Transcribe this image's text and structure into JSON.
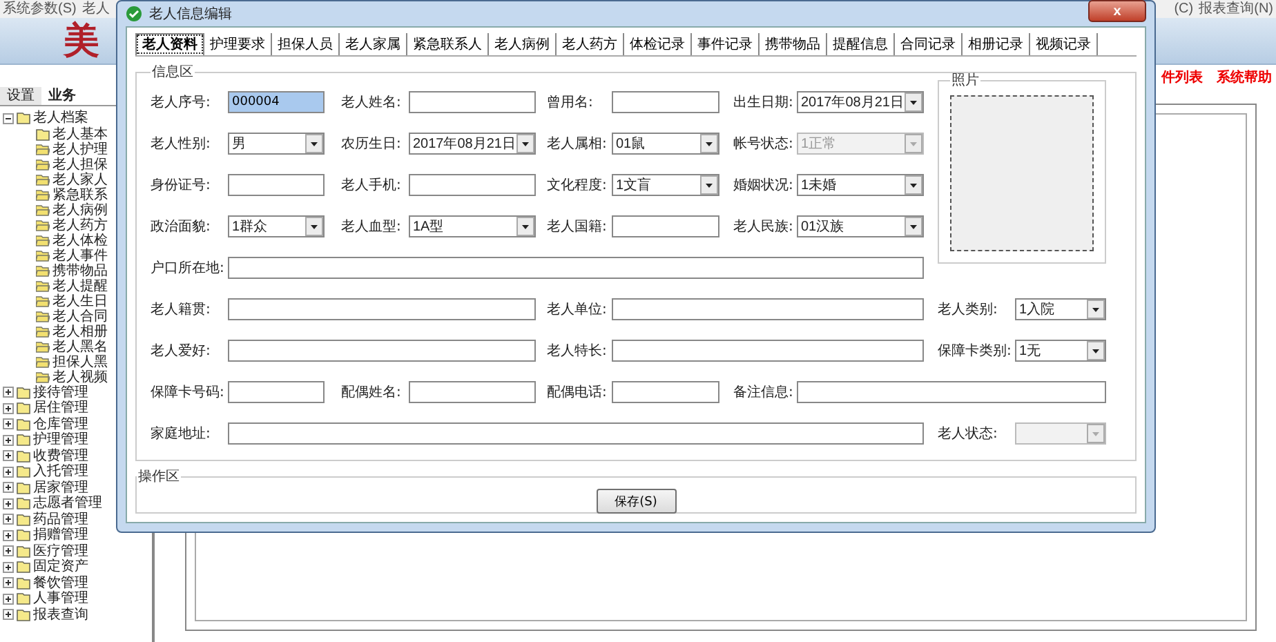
{
  "menu_bar": {
    "left": [
      "系统参数(S)",
      "老人"
    ],
    "right": [
      "(C)",
      "报表查询(N)"
    ]
  },
  "header": {
    "logo": "美",
    "links": [
      "件列表",
      "系统帮助"
    ]
  },
  "sidebar": {
    "tabs": [
      {
        "label": "设置",
        "selected": false
      },
      {
        "label": "业务",
        "selected": true
      }
    ],
    "tree": [
      {
        "label": "老人档案",
        "expanded": true,
        "children": [
          "老人基本",
          "老人护理",
          "老人担保",
          "老人家人",
          "紧急联系",
          "老人病例",
          "老人药方",
          "老人体检",
          "老人事件",
          "携带物品",
          "老人提醒",
          "老人生日",
          "老人合同",
          "老人相册",
          "老人黑名",
          "担保人黑",
          "老人视频"
        ]
      },
      {
        "label": "接待管理",
        "expanded": false
      },
      {
        "label": "居住管理",
        "expanded": false
      },
      {
        "label": "仓库管理",
        "expanded": false
      },
      {
        "label": "护理管理",
        "expanded": false
      },
      {
        "label": "收费管理",
        "expanded": false
      },
      {
        "label": "入托管理",
        "expanded": false
      },
      {
        "label": "居家管理",
        "expanded": false
      },
      {
        "label": "志愿者管理",
        "expanded": false
      },
      {
        "label": "药品管理",
        "expanded": false
      },
      {
        "label": "捐赠管理",
        "expanded": false
      },
      {
        "label": "医疗管理",
        "expanded": false
      },
      {
        "label": "固定资产",
        "expanded": false
      },
      {
        "label": "餐饮管理",
        "expanded": false
      },
      {
        "label": "人事管理",
        "expanded": false
      },
      {
        "label": "报表查询",
        "expanded": false
      }
    ]
  },
  "dialog": {
    "title": "老人信息编辑",
    "close": "x",
    "tabs": [
      {
        "label": "老人资料",
        "selected": true
      },
      {
        "label": "护理要求",
        "selected": false
      },
      {
        "label": "担保人员",
        "selected": false
      },
      {
        "label": "老人家属",
        "selected": false
      },
      {
        "label": "紧急联系人",
        "selected": false
      },
      {
        "label": "老人病例",
        "selected": false
      },
      {
        "label": "老人药方",
        "selected": false
      },
      {
        "label": "体检记录",
        "selected": false
      },
      {
        "label": "事件记录",
        "selected": false
      },
      {
        "label": "携带物品",
        "selected": false
      },
      {
        "label": "提醒信息",
        "selected": false
      },
      {
        "label": "合同记录",
        "selected": false
      },
      {
        "label": "相册记录",
        "selected": false
      },
      {
        "label": "视频记录",
        "selected": false
      }
    ],
    "info_group": "信息区",
    "photo_label": "照片",
    "rows": [
      [
        {
          "label": "老人序号:",
          "kind": "text",
          "value": "000004",
          "focused": true
        },
        {
          "label": "老人姓名:",
          "kind": "text"
        },
        {
          "label": "曾用名:",
          "kind": "text"
        },
        {
          "label": "出生日期:",
          "kind": "select",
          "value": "2017年08月21日",
          "disabled": false
        }
      ],
      [
        {
          "label": "老人性别:",
          "kind": "select",
          "value": "男",
          "disabled": false
        },
        {
          "label": "农历生日:",
          "kind": "select",
          "value": "2017年08月21日",
          "disabled": false
        },
        {
          "label": "老人属相:",
          "kind": "select",
          "value": "01鼠",
          "disabled": false
        },
        {
          "label": "帐号状态:",
          "kind": "select",
          "value": "1正常",
          "disabled": true
        }
      ],
      [
        {
          "label": "身份证号:",
          "kind": "text"
        },
        {
          "label": "老人手机:",
          "kind": "text"
        },
        {
          "label": "文化程度:",
          "kind": "select",
          "value": "1文盲",
          "disabled": false
        },
        {
          "label": "婚姻状况:",
          "kind": "select",
          "value": "1未婚",
          "disabled": false
        }
      ],
      [
        {
          "label": "政治面貌:",
          "kind": "select",
          "value": "1群众",
          "disabled": false
        },
        {
          "label": "老人血型:",
          "kind": "select",
          "value": "1A型",
          "disabled": false
        },
        {
          "label": "老人国籍:",
          "kind": "text"
        },
        {
          "label": "老人民族:",
          "kind": "select",
          "value": "01汉族",
          "disabled": false
        }
      ],
      [
        {
          "label": "户口所在地:",
          "kind": "text"
        }
      ],
      [
        {
          "label": "老人籍贯:",
          "kind": "text"
        },
        {
          "label": "老人单位:",
          "kind": "text"
        },
        {
          "label": "老人类别:",
          "kind": "select",
          "value": "1入院",
          "disabled": false
        }
      ],
      [
        {
          "label": "老人爱好:",
          "kind": "text"
        },
        {
          "label": "老人特长:",
          "kind": "text"
        },
        {
          "label": "保障卡类别:",
          "kind": "select",
          "value": "1无",
          "disabled": false
        }
      ],
      [
        {
          "label": "保障卡号码:",
          "kind": "text"
        },
        {
          "label": "配偶姓名:",
          "kind": "text"
        },
        {
          "label": "配偶电话:",
          "kind": "text"
        },
        {
          "label": "备注信息:",
          "kind": "text"
        }
      ],
      [
        {
          "label": "家庭地址:",
          "kind": "text"
        },
        {
          "label": "老人状态:",
          "kind": "select",
          "disabled": true
        }
      ]
    ],
    "action_group": "操作区",
    "save_button": "保存(S)"
  }
}
